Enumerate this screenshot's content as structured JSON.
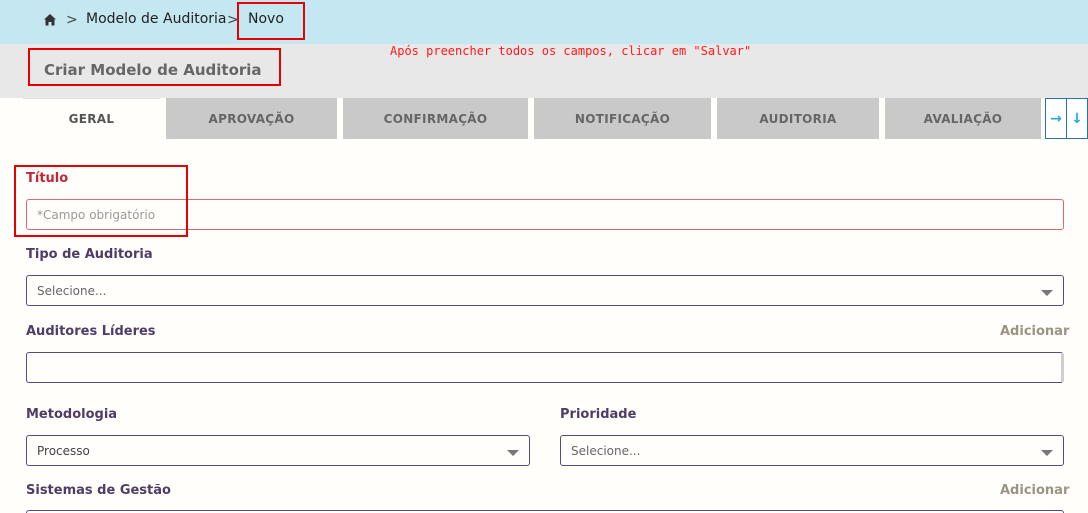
{
  "breadcrumb": {
    "home_icon": "home-icon",
    "separator": ">",
    "items": [
      "Modelo de Auditoria",
      "Novo"
    ]
  },
  "header": {
    "title": "Criar Modelo de Auditoria",
    "instruction": "Após preencher todos os campos, clicar em \"Salvar\""
  },
  "tabs": [
    {
      "label": "GERAL",
      "active": true
    },
    {
      "label": "APROVAÇÃO"
    },
    {
      "label": "CONFIRMAÇÃO"
    },
    {
      "label": "NOTIFICAÇÃO"
    },
    {
      "label": "AUDITORIA"
    },
    {
      "label": "AVALIAÇÃO"
    }
  ],
  "tab_scroll": {
    "right_icon": "arrow-right-icon",
    "down_icon": "arrow-down-icon"
  },
  "form": {
    "titulo": {
      "label": "Título",
      "placeholder": "*Campo obrigatório",
      "value": ""
    },
    "tipo": {
      "label": "Tipo de Auditoria",
      "value": "Selecione..."
    },
    "auditores": {
      "label": "Auditores Líderes",
      "add_label": "Adicionar",
      "value": ""
    },
    "metodologia": {
      "label": "Metodologia",
      "value": "Processo"
    },
    "prioridade": {
      "label": "Prioridade",
      "value": "Selecione..."
    },
    "sistemas": {
      "label": "Sistemas de Gestão",
      "add_label": "Adicionar"
    }
  },
  "colors": {
    "breadcrumb_bg": "#c4e7f1",
    "header_bg": "#e8e8e8",
    "highlight": "#e60000",
    "label": "#4e3d68",
    "required_label": "#c0283a",
    "tab_arrow": "#29a7dc"
  }
}
